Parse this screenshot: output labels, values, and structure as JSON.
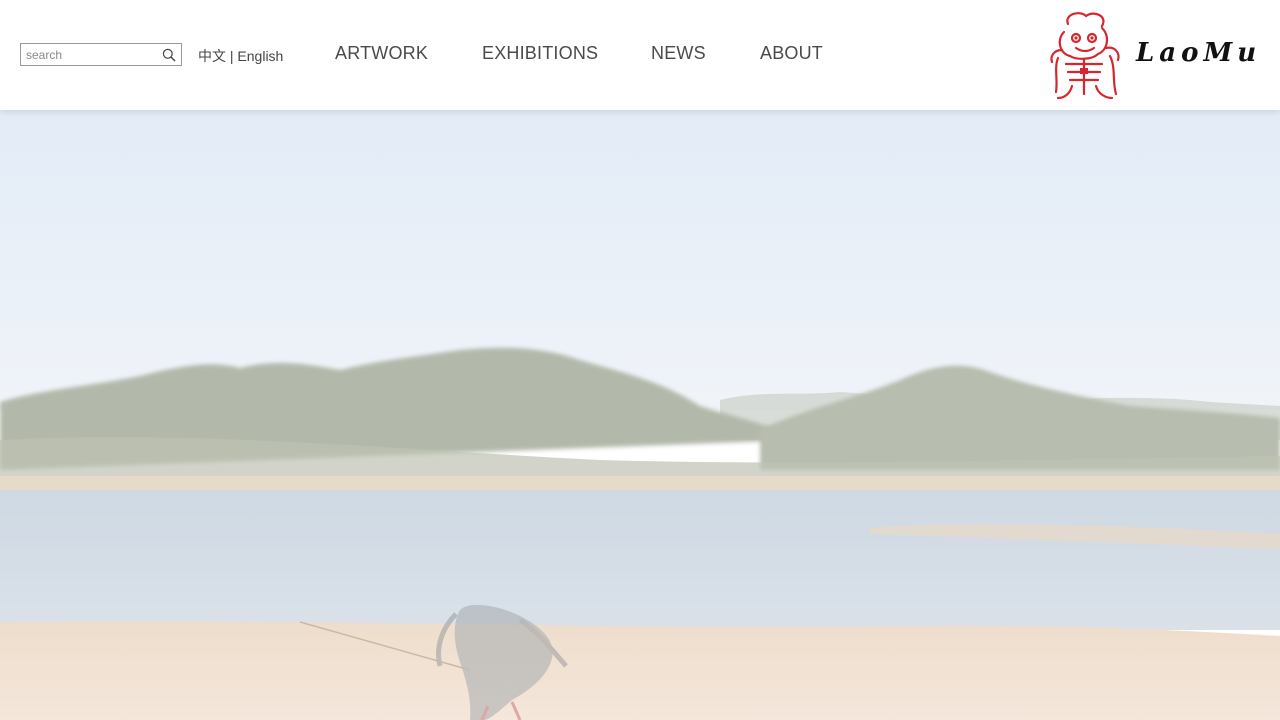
{
  "search": {
    "placeholder": "search",
    "value": ""
  },
  "language": {
    "chinese": "中文",
    "separator": " | ",
    "english": "English"
  },
  "nav": {
    "items": [
      {
        "label": "ARTWORK"
      },
      {
        "label": "EXHIBITIONS"
      },
      {
        "label": "NEWS"
      },
      {
        "label": "ABOUT"
      }
    ]
  },
  "logo": {
    "text": "LaoMu",
    "seal_color": "#d8262e"
  },
  "hero": {
    "image": "hazy lake landscape with forested hills, calm water and sandy shore with a draped figure"
  },
  "colors": {
    "nav_text": "#4a4a4a",
    "border": "#9a9a9a",
    "accent": "#d8262e"
  }
}
